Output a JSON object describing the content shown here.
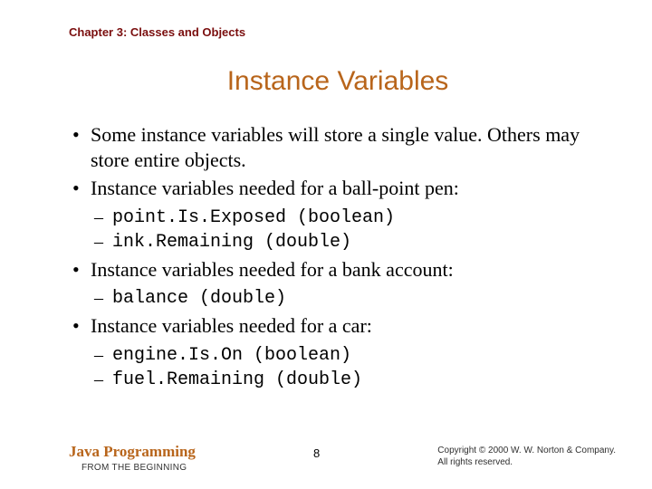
{
  "header": {
    "chapter": "Chapter 3: Classes and Objects"
  },
  "title": "Instance Variables",
  "bullets": [
    {
      "text": "Some instance variables will store a single value. Others may store entire objects.",
      "sub": []
    },
    {
      "text": "Instance variables needed for a ball-point pen:",
      "sub": [
        "point.Is.Exposed (boolean)",
        "ink.Remaining (double)"
      ]
    },
    {
      "text": "Instance variables needed for a bank account:",
      "sub": [
        "balance (double)"
      ]
    },
    {
      "text": "Instance variables needed for a car:",
      "sub": [
        "engine.Is.On (boolean)",
        "fuel.Remaining (double)"
      ]
    }
  ],
  "footer": {
    "book_title": "Java Programming",
    "book_sub": "FROM THE BEGINNING",
    "page_number": "8",
    "copyright_line1": "Copyright © 2000 W. W. Norton & Company.",
    "copyright_line2": "All rights reserved."
  }
}
